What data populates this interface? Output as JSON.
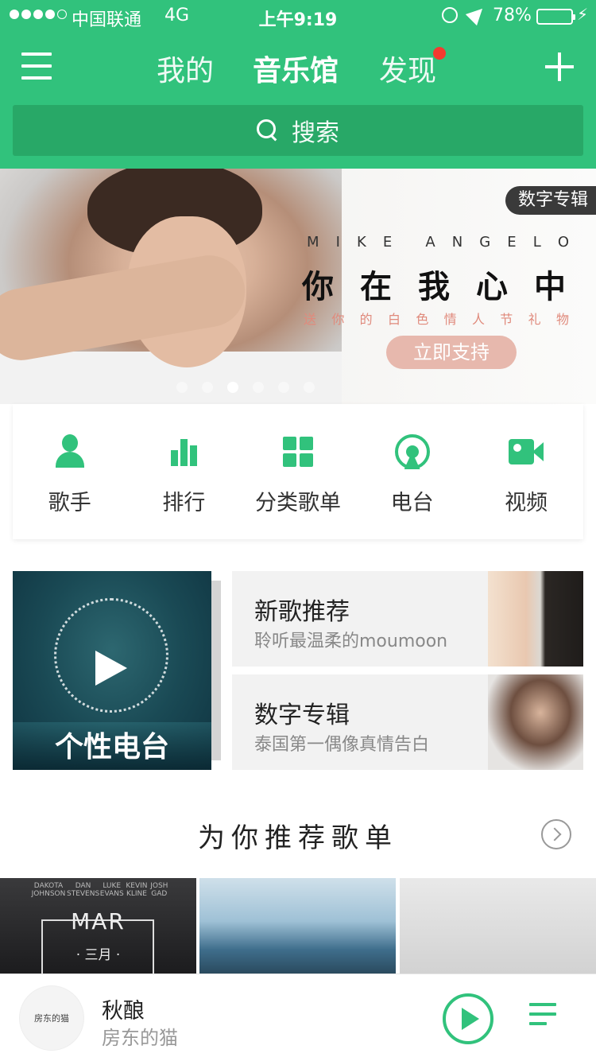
{
  "status_bar": {
    "carrier": "中国联通",
    "network": "4G",
    "time": "上午9:19",
    "battery_pct": "78%",
    "battery_level": 0.78,
    "signal_bars_filled": 4,
    "signal_bars_total": 5
  },
  "header": {
    "tabs": [
      "我的",
      "音乐馆",
      "发现"
    ],
    "active_tab": "音乐馆",
    "discover_has_badge": true,
    "search_placeholder": "搜索"
  },
  "banner": {
    "badge": "数字专辑",
    "artist_letters": [
      "M",
      "I",
      "K",
      "E",
      "A",
      "N",
      "G",
      "E",
      "L",
      "O"
    ],
    "title_chars": [
      "你",
      "在",
      "我",
      "心",
      "中"
    ],
    "subtitle_chars": [
      "送",
      "你",
      "的",
      "白",
      "色",
      "情",
      "人",
      "节",
      "礼",
      "物"
    ],
    "cta": "立即支持",
    "page_count": 6,
    "active_page": 3
  },
  "categories": [
    {
      "label": "歌手",
      "icon": "singer-icon"
    },
    {
      "label": "排行",
      "icon": "chart-bars-icon"
    },
    {
      "label": "分类歌单",
      "icon": "grid-icon"
    },
    {
      "label": "电台",
      "icon": "radio-icon"
    },
    {
      "label": "视频",
      "icon": "video-camera-icon"
    }
  ],
  "features": {
    "personal_radio": "个性电台",
    "cards": [
      {
        "title": "新歌推荐",
        "subtitle": "聆听最温柔的moumoon"
      },
      {
        "title": "数字专辑",
        "subtitle": "泰国第一偶像真情告白"
      }
    ]
  },
  "playlists": {
    "section_title": "为你推荐歌单",
    "first_cover": {
      "names": [
        "DAKOTA JOHNSON",
        "DAN STEVENS",
        "LUKE EVANS",
        "KEVIN KLINE",
        "JOSH GAD"
      ],
      "mar": "MAR",
      "cn": "· 三月 ·"
    }
  },
  "player": {
    "cover_text": "房东的猫",
    "song": "秋酿",
    "artist": "房东的猫"
  },
  "colors": {
    "brand": "#31c27c",
    "badge_red": "#f43b30"
  }
}
